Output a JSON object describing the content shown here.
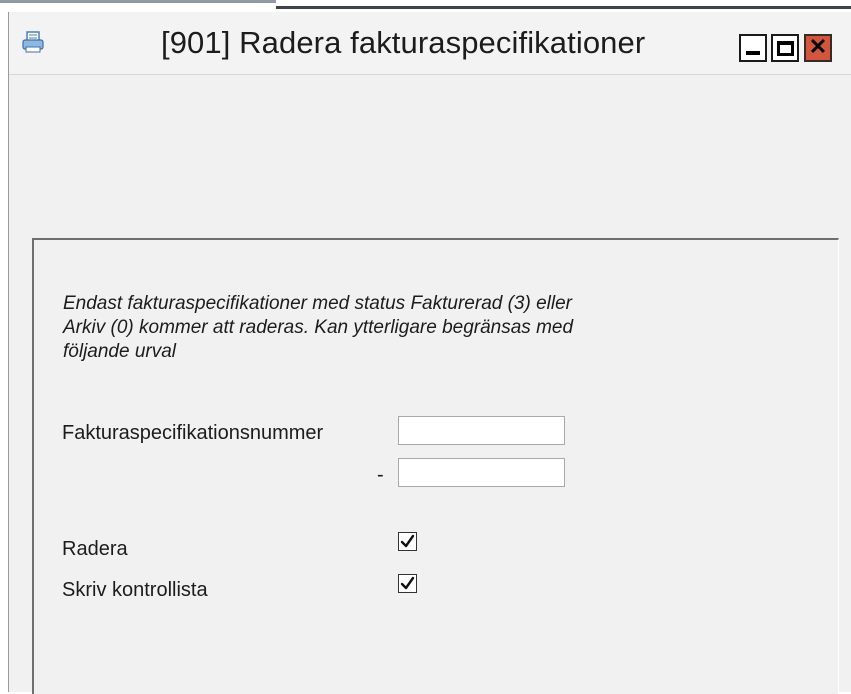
{
  "window": {
    "title": "[901]  Radera fakturaspecifikationer",
    "controls": {
      "minimize_icon": "minimize-icon",
      "maximize_icon": "maximize-icon",
      "close_icon": "close-icon",
      "close_symbol": "✕"
    },
    "close_color": "#d2563d"
  },
  "form": {
    "info_text": "Endast fakturaspecifikationer med status Fakturerad (3) eller Arkiv (0) kommer att raderas. Kan ytterligare begränsas med följande urval",
    "range": {
      "label": "Fakturaspecifikationsnummer",
      "separator": "-",
      "from_value": "",
      "to_value": ""
    },
    "options": [
      {
        "label": "Radera",
        "checked": true
      },
      {
        "label": "Skriv kontrollista",
        "checked": true
      }
    ]
  }
}
